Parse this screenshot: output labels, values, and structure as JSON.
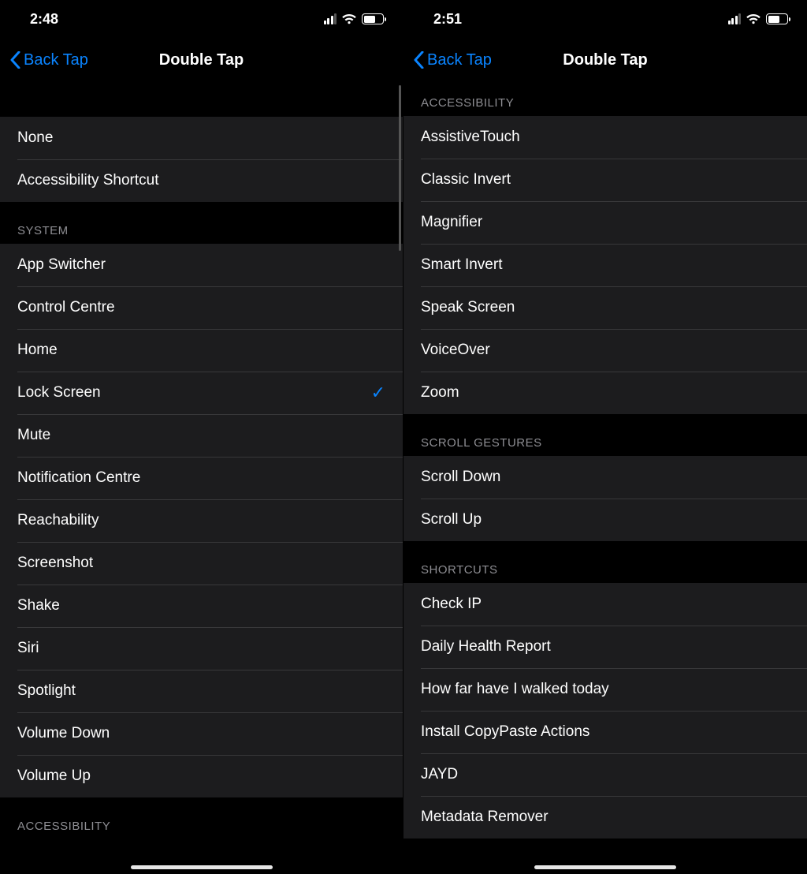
{
  "left": {
    "status": {
      "time": "2:48"
    },
    "nav": {
      "back_label": "Back Tap",
      "title": "Double Tap"
    },
    "topGroup": {
      "items": [
        {
          "label": "None"
        },
        {
          "label": "Accessibility Shortcut"
        }
      ]
    },
    "system": {
      "header": "System",
      "items": [
        {
          "label": "App Switcher"
        },
        {
          "label": "Control Centre"
        },
        {
          "label": "Home"
        },
        {
          "label": "Lock Screen",
          "selected": true
        },
        {
          "label": "Mute"
        },
        {
          "label": "Notification Centre"
        },
        {
          "label": "Reachability"
        },
        {
          "label": "Screenshot"
        },
        {
          "label": "Shake"
        },
        {
          "label": "Siri"
        },
        {
          "label": "Spotlight"
        },
        {
          "label": "Volume Down"
        },
        {
          "label": "Volume Up"
        }
      ]
    },
    "accessibility_header": "Accessibility"
  },
  "right": {
    "status": {
      "time": "2:51"
    },
    "nav": {
      "back_label": "Back Tap",
      "title": "Double Tap"
    },
    "accessibility": {
      "header": "Accessibility",
      "items": [
        {
          "label": "AssistiveTouch"
        },
        {
          "label": "Classic Invert"
        },
        {
          "label": "Magnifier"
        },
        {
          "label": "Smart Invert"
        },
        {
          "label": "Speak Screen"
        },
        {
          "label": "VoiceOver"
        },
        {
          "label": "Zoom"
        }
      ]
    },
    "scroll_gestures": {
      "header": "Scroll Gestures",
      "items": [
        {
          "label": "Scroll Down"
        },
        {
          "label": "Scroll Up"
        }
      ]
    },
    "shortcuts": {
      "header": "Shortcuts",
      "items": [
        {
          "label": "Check IP"
        },
        {
          "label": "Daily Health Report"
        },
        {
          "label": "How far have I walked today"
        },
        {
          "label": "Install CopyPaste Actions"
        },
        {
          "label": "JAYD"
        },
        {
          "label": "Metadata Remover"
        }
      ]
    }
  }
}
